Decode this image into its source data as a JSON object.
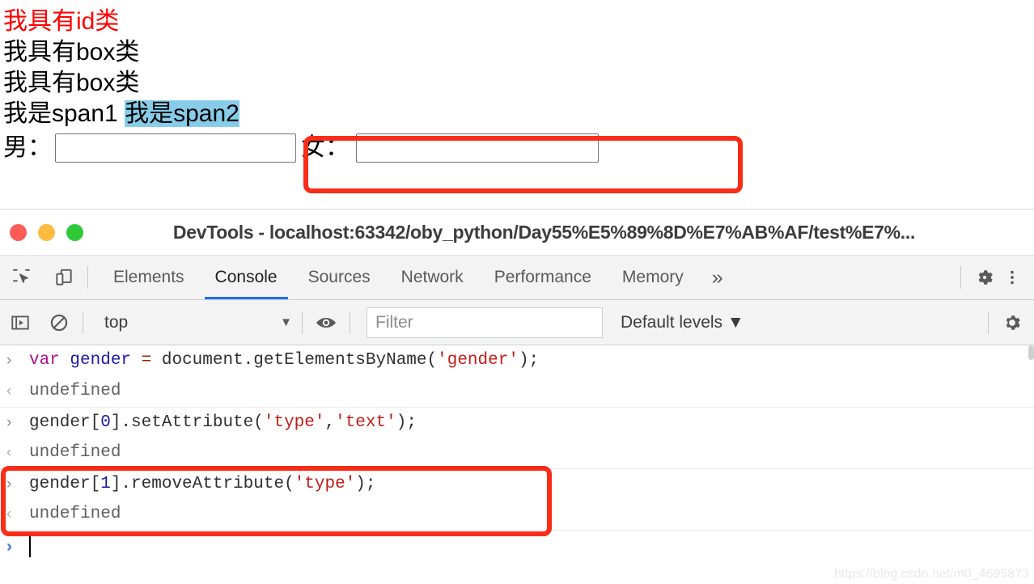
{
  "webpage": {
    "lines": [
      {
        "text": "我具有id类",
        "color": "#ff0000"
      },
      {
        "text": "我具有box类",
        "color": "#000000"
      },
      {
        "text": "我具有box类",
        "color": "#000000"
      }
    ],
    "span_line": {
      "span1": "我是span1",
      "span2": "我是span2",
      "highlight_color": "#87cdea"
    },
    "form": {
      "male_label": "男：",
      "male_value": "",
      "male_placeholder": "",
      "female_label": "女：",
      "female_value": "",
      "female_placeholder": ""
    }
  },
  "devtools": {
    "title": "DevTools - localhost:63342/oby_python/Day55%E5%89%8D%E7%AB%AF/test%E7%...",
    "window_buttons": [
      {
        "name": "close",
        "color": "#fc5c57"
      },
      {
        "name": "minimize",
        "color": "#fdbc40"
      },
      {
        "name": "zoom",
        "color": "#2fc938"
      }
    ],
    "toolbar_icons": [
      {
        "name": "inspect-element-icon"
      },
      {
        "name": "device-toolbar-icon"
      }
    ],
    "tabs": [
      {
        "label": "Elements",
        "active": false
      },
      {
        "label": "Console",
        "active": true
      },
      {
        "label": "Sources",
        "active": false
      },
      {
        "label": "Network",
        "active": false
      },
      {
        "label": "Performance",
        "active": false
      },
      {
        "label": "Memory",
        "active": false
      }
    ],
    "more_tabs_label": "»",
    "settings_icon": "gear-icon",
    "menu_icon": "kebab-menu-icon",
    "accent_color": "#1a73e8"
  },
  "console_toolbar": {
    "sidebar_toggle_icon": "console-sidebar-icon",
    "clear_icon": "clear-console-icon",
    "context_value": "top",
    "context_caret": "▼",
    "eye_icon": "live-expression-eye-icon",
    "filter_placeholder": "Filter",
    "filter_value": "",
    "levels_label": "Default levels",
    "levels_caret": "▼",
    "settings_icon": "console-settings-gear-icon"
  },
  "console": {
    "messages": [
      {
        "kind": "input",
        "gutter": "›",
        "tokens": [
          {
            "text": "var ",
            "type": "kw"
          },
          {
            "text": "gender ",
            "type": "var"
          },
          {
            "text": "= ",
            "type": "op"
          },
          {
            "text": "document.getElementsByName(",
            "type": "plain"
          },
          {
            "text": "'gender'",
            "type": "str"
          },
          {
            "text": ");",
            "type": "plain"
          }
        ]
      },
      {
        "kind": "output",
        "gutter": "‹",
        "tokens": [
          {
            "text": "undefined",
            "type": "dim"
          }
        ]
      },
      {
        "kind": "input",
        "gutter": "›",
        "tokens": [
          {
            "text": "gender[",
            "type": "plain"
          },
          {
            "text": "0",
            "type": "num"
          },
          {
            "text": "].setAttribute(",
            "type": "plain"
          },
          {
            "text": "'type'",
            "type": "str"
          },
          {
            "text": ",",
            "type": "plain"
          },
          {
            "text": "'text'",
            "type": "str"
          },
          {
            "text": ");",
            "type": "plain"
          }
        ]
      },
      {
        "kind": "output",
        "gutter": "‹",
        "tokens": [
          {
            "text": "undefined",
            "type": "dim"
          }
        ]
      },
      {
        "kind": "input",
        "gutter": "›",
        "tokens": [
          {
            "text": "gender[",
            "type": "plain"
          },
          {
            "text": "1",
            "type": "num"
          },
          {
            "text": "].removeAttribute(",
            "type": "plain"
          },
          {
            "text": "'type'",
            "type": "str"
          },
          {
            "text": ");",
            "type": "plain"
          }
        ]
      },
      {
        "kind": "output",
        "gutter": "‹",
        "tokens": [
          {
            "text": "undefined",
            "type": "dim"
          }
        ]
      }
    ],
    "prompt_chevron": "›",
    "prompt_value": ""
  },
  "annotations": [
    {
      "name": "female-field-highlight",
      "color": "#fa2d18"
    },
    {
      "name": "remove-attribute-highlight",
      "color": "#fa2d18"
    }
  ],
  "watermark": "https://blog.csdn.net/m0_4695873"
}
